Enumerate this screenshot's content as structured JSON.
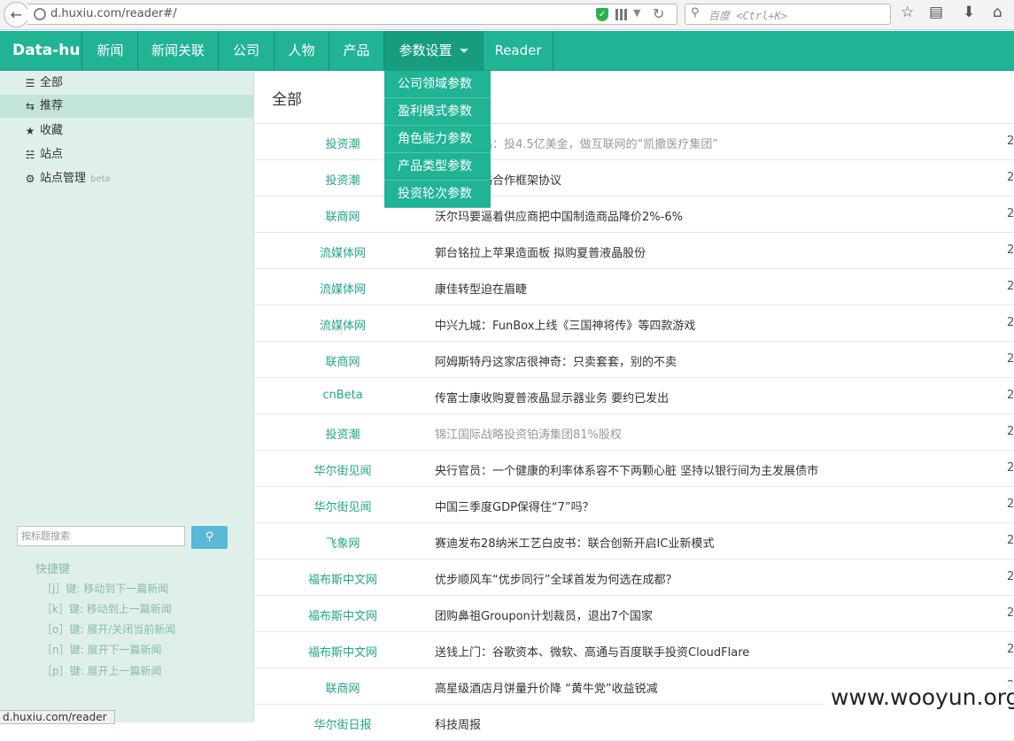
{
  "browser": {
    "url": "d.huxiu.com/reader#/",
    "search_placeholder": "百度 <Ctrl+K>"
  },
  "navbar": {
    "brand": "Data-hu",
    "items": [
      "新闻",
      "新闻关联",
      "公司",
      "人物",
      "产品",
      "参数设置",
      "Reader"
    ]
  },
  "dropdown": {
    "items": [
      "公司领域参数",
      "盈利模式参数",
      "角色能力参数",
      "产品类型参数",
      "投资轮次参数"
    ]
  },
  "sidebar": {
    "items": [
      {
        "icon": "list-icon",
        "label": "全部"
      },
      {
        "icon": "retweet-icon",
        "label": "推荐"
      },
      {
        "icon": "star-icon",
        "label": "收藏"
      },
      {
        "icon": "sitemap-icon",
        "label": "站点"
      },
      {
        "icon": "gear-icon",
        "label": "站点管理",
        "badge": "beta"
      }
    ],
    "search_placeholder": "按标题搜索",
    "shortcut_title": "快捷键",
    "shortcuts": [
      "［j］键: 移动到下一篇新闻",
      "［k］键: 移动到上一篇新闻",
      "［o］键: 展开/关闭当前新闻",
      "［n］键: 展开下一篇新闻",
      "［p］键: 展开上一篇新闻"
    ]
  },
  "main": {
    "title": "全部",
    "rows": [
      {
        "source": "投资潮",
        "title": "…核心战略：投4.5亿美金，做互联网的“凯撒医疗集团”",
        "date": "2",
        "read": true
      },
      {
        "source": "投资潮",
        "title": "…签署战略合作框架协议",
        "date": "2",
        "read": false
      },
      {
        "source": "联商网",
        "title": "沃尔玛要逼着供应商把中国制造商品降价2%-6%",
        "date": "2",
        "read": false
      },
      {
        "source": "流媒体网",
        "title": "郭台铭拉上苹果造面板 拟购夏普液晶股份",
        "date": "2",
        "read": false
      },
      {
        "source": "流媒体网",
        "title": "康佳转型迫在眉睫",
        "date": "2",
        "read": false
      },
      {
        "source": "流媒体网",
        "title": "中兴九城：FunBox上线《三国神将传》等四款游戏",
        "date": "2",
        "read": false
      },
      {
        "source": "联商网",
        "title": "阿姆斯特丹这家店很神奇：只卖套套，别的不卖",
        "date": "2",
        "read": false
      },
      {
        "source": "cnBeta",
        "title": "传富士康收购夏普液晶显示器业务 要约已发出",
        "date": "2",
        "read": false
      },
      {
        "source": "投资潮",
        "title": "锦江国际战略投资铂涛集团81%股权",
        "date": "2",
        "read": true
      },
      {
        "source": "华尔街见闻",
        "title": "央行官员：一个健康的利率体系容不下两颗心脏 坚持以银行间为主发展债市",
        "date": "2",
        "read": false
      },
      {
        "source": "华尔街见闻",
        "title": "中国三季度GDP保得住“7”吗？",
        "date": "2",
        "read": false
      },
      {
        "source": "飞象网",
        "title": "赛迪发布28纳米工艺白皮书：联合创新开启IC业新模式",
        "date": "2",
        "read": false
      },
      {
        "source": "福布斯中文网",
        "title": "优步顺风车“优步同行”全球首发为何选在成都？",
        "date": "2",
        "read": false
      },
      {
        "source": "福布斯中文网",
        "title": "团购鼻祖Groupon计划裁员，退出7个国家",
        "date": "2",
        "read": false
      },
      {
        "source": "福布斯中文网",
        "title": "送钱上门：谷歌资本、微软、高通与百度联手投资CloudFlare",
        "date": "2",
        "read": false
      },
      {
        "source": "联商网",
        "title": "高星级酒店月饼量升价降 “黄牛党”收益锐减",
        "date": "2",
        "read": false
      },
      {
        "source": "华尔街日报",
        "title": "科技周报",
        "date": "",
        "read": false
      }
    ]
  },
  "status_tip": "d.huxiu.com/reader",
  "watermark": "www.wooyun.org",
  "colors": {
    "nav": "#20b394",
    "sidebar": "#dff0eb",
    "link": "#20a68a"
  }
}
